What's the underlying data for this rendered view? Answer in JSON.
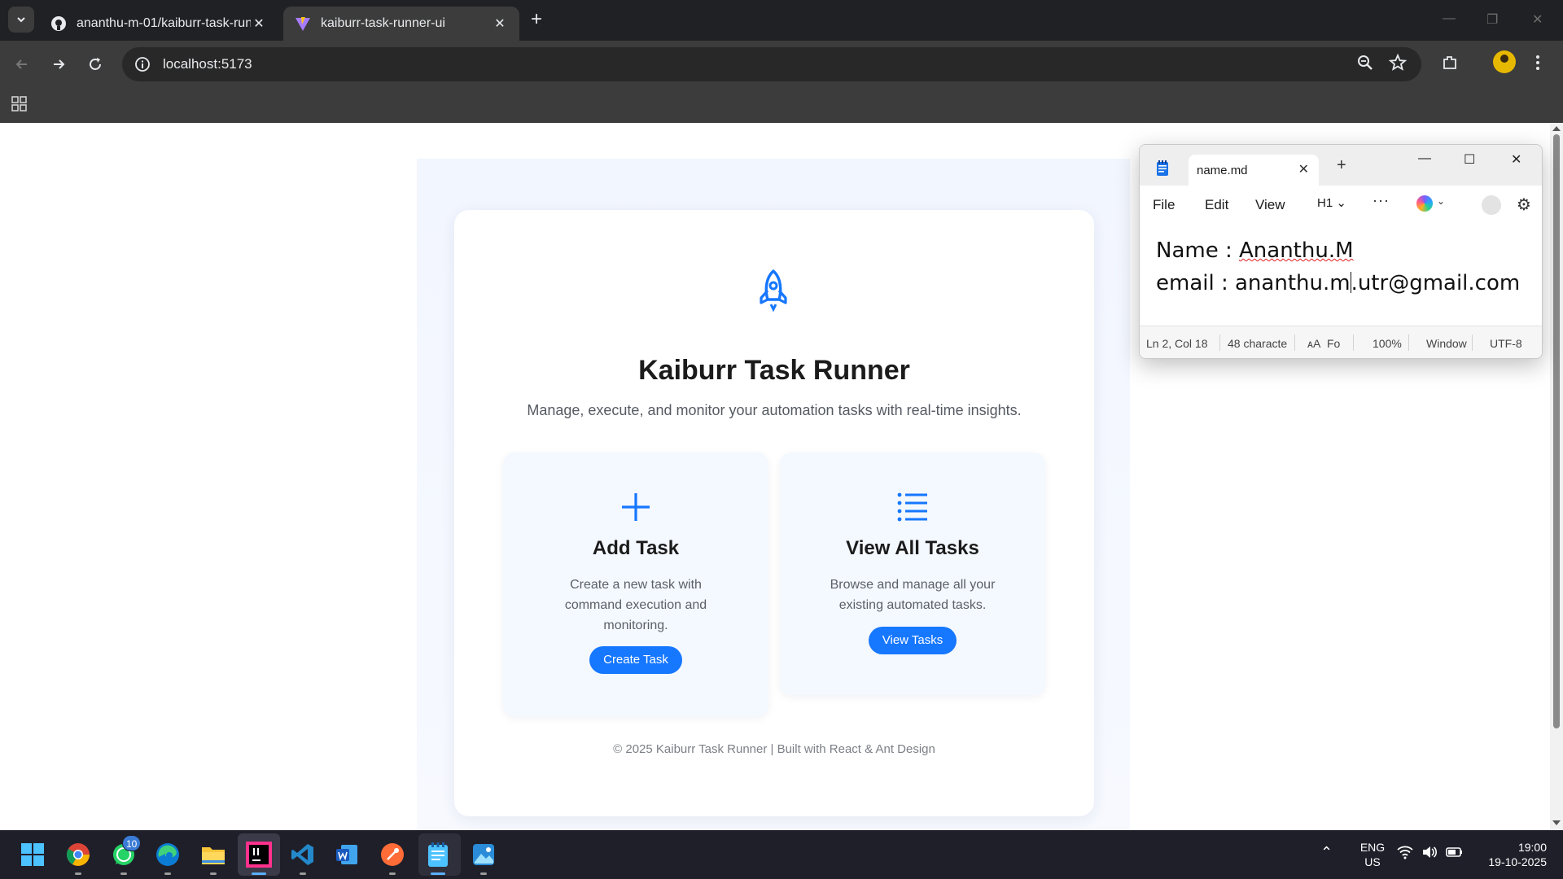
{
  "browser": {
    "tabs": [
      {
        "title": "ananthu-m-01/kaiburr-task-run",
        "active": false
      },
      {
        "title": "kaiburr-task-runner-ui",
        "active": true
      }
    ],
    "url": "localhost:5173",
    "accent": "#1677ff"
  },
  "page": {
    "title": "Kaiburr Task Runner",
    "subtitle": "Manage, execute, and monitor your automation tasks with real-time insights.",
    "cards": [
      {
        "title": "Add Task",
        "description": "Create a new task with command execution and monitoring.",
        "button": "Create Task",
        "icon": "plus-icon"
      },
      {
        "title": "View All Tasks",
        "description": "Browse and manage all your existing automated tasks.",
        "button": "View Tasks",
        "icon": "list-icon"
      }
    ],
    "footer": "© 2025 Kaiburr Task Runner | Built with React & Ant Design"
  },
  "notepad": {
    "tab_name": "name.md",
    "menu": {
      "file": "File",
      "edit": "Edit",
      "view": "View",
      "heading": "H1",
      "more": "···"
    },
    "content": {
      "line1_prefix": "Name : ",
      "line1_name": "Ananthu.M",
      "line2_before_caret": "email : ananthu.m",
      "line2_after_caret": ".utr@gmail.com"
    },
    "status": {
      "position": "Ln 2, Col 18",
      "characters": "48 characte",
      "font": "Fo",
      "zoom": "100%",
      "line_ending": "Window",
      "encoding": "UTF-8"
    }
  },
  "taskbar": {
    "whatsapp_badge": "10",
    "language": "ENG",
    "region": "US",
    "time": "19:00",
    "date": "19-10-2025"
  }
}
